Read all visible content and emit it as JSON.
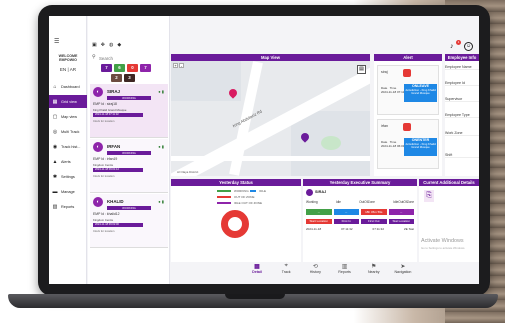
{
  "app": {
    "brand_line1": "WELCOME",
    "brand_line2": "EMPOWIO",
    "lang": "EN | AR"
  },
  "colors": {
    "primary": "#6a1b9a",
    "alert_red": "#e53935",
    "info_blue": "#1e88e5",
    "green": "#43a047"
  },
  "sidebar": {
    "items": [
      {
        "label": "Dashboard",
        "icon": "home-icon"
      },
      {
        "label": "Grid view",
        "icon": "grid-icon"
      },
      {
        "label": "Map view",
        "icon": "map-icon"
      },
      {
        "label": "Multi Track",
        "icon": "multi-track-icon"
      },
      {
        "label": "Track hist...",
        "icon": "history-icon"
      },
      {
        "label": "Alerts",
        "icon": "alert-icon"
      },
      {
        "label": "Settings",
        "icon": "gear-icon"
      },
      {
        "label": "Manage",
        "icon": "manage-icon"
      },
      {
        "label": "Reports",
        "icon": "reports-icon"
      }
    ]
  },
  "list": {
    "search_placeholder": "Search",
    "chips_row1": [
      "7",
      "6",
      "0",
      "7"
    ],
    "chips_row2": [
      "2",
      "3"
    ],
    "cards": [
      {
        "name": "SIRAJ",
        "status": "WORKING",
        "emp_id": "EMP Id : siraj18",
        "location": "King Khalid Grand Mosque",
        "time": "2024-11-18 07:11:32",
        "clock": "Clock for location"
      },
      {
        "name": "IRFAN",
        "status": "WORKING",
        "emp_id": "EMP Id : irfan19",
        "location": "Kingdom Centre",
        "time": "2024-11-18 06:01:12",
        "clock": "Clock for location"
      },
      {
        "name": "KHALID",
        "status": "WORKING",
        "emp_id": "EMP Id : khalid12",
        "location": "Kingdom Centre",
        "time": "2024-11-18 06:02:00",
        "clock": "Clock for location"
      }
    ]
  },
  "map": {
    "title": "Map View",
    "zoom_in": "+",
    "zoom_out": "-",
    "street": "King Abdulaziz Rd",
    "footer": "Al Olaya District"
  },
  "alert": {
    "title": "Alert",
    "cards": [
      {
        "who": "siraj",
        "date_label": "Date",
        "time_label": "Time",
        "date": "2024-11-18",
        "time": "07:11",
        "badge_title": "ONLEAVE",
        "badge_text": "Jurisdiction - King Khalid Grand Mosque"
      },
      {
        "who": "irfan",
        "date_label": "Date",
        "time_label": "Time",
        "date": "2024-11-18",
        "time": "06:01",
        "badge_title": "ONENTER",
        "badge_text": "Jurisdiction - King Khalid Grand Mosque"
      }
    ]
  },
  "employee_info": {
    "title": "Employee Info",
    "rows": [
      {
        "label": "Employee Name",
        "value": "siraj"
      },
      {
        "label": "Employee Id",
        "value": "siraj18"
      },
      {
        "label": "Supervisor",
        "value": "empdemo.empdemo.co"
      },
      {
        "label": "Employee Type",
        "value": "Emergency-workers"
      },
      {
        "label": "Work Zone",
        "value": "King Khalid Grand Mosque"
      },
      {
        "label": "Shift",
        "value": "Morning"
      }
    ]
  },
  "yesterday": {
    "title": "Yesterday Status",
    "legend": [
      "WORKING",
      "IDLE",
      "OUT OF ZONE",
      "IDLE OUT OF ZONE"
    ]
  },
  "executive": {
    "title": "Yesterday Executive Summary",
    "name": "SIRAJ",
    "tabs": [
      "Working",
      "Idle",
      "OutOfZone",
      "IdleOutOfZone"
    ],
    "values": [
      "--",
      "--",
      "18h 45m 59s",
      "--"
    ],
    "rows": [
      "Start Location",
      "First In",
      "First Out",
      "Stat Location"
    ],
    "meta": [
      "2024-11-18",
      "07:11:32",
      "07:11:32",
      "ZE Stat"
    ]
  },
  "additional": {
    "title": "Current Additional Details",
    "watermark": "Activate Windows",
    "watermark_sub": "Go to Settings to activate Windows."
  },
  "bottom": {
    "items": [
      {
        "label": "Detail",
        "icon": "detail-icon"
      },
      {
        "label": "Track",
        "icon": "track-icon"
      },
      {
        "label": "History",
        "icon": "history-icon"
      },
      {
        "label": "Reports",
        "icon": "reports-icon"
      },
      {
        "label": "Nearby",
        "icon": "nearby-icon"
      },
      {
        "label": "Navigation",
        "icon": "navigation-icon"
      }
    ]
  },
  "notifications": {
    "count": "1"
  }
}
